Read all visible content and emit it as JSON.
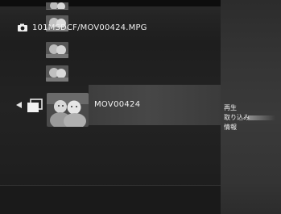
{
  "path": {
    "text": "101MSDCF/MOV00424.MPG",
    "icon": "camera-icon"
  },
  "selected": {
    "filename": "MOV00424"
  },
  "menu": {
    "items": [
      {
        "label": "再生",
        "active": false
      },
      {
        "label": "取り込み",
        "active": true
      },
      {
        "label": "情報",
        "active": false
      }
    ]
  },
  "colors": {
    "background": "#1c1c1c",
    "panel": "#353535",
    "selection": "#474747",
    "text": "#f0f0f0"
  }
}
